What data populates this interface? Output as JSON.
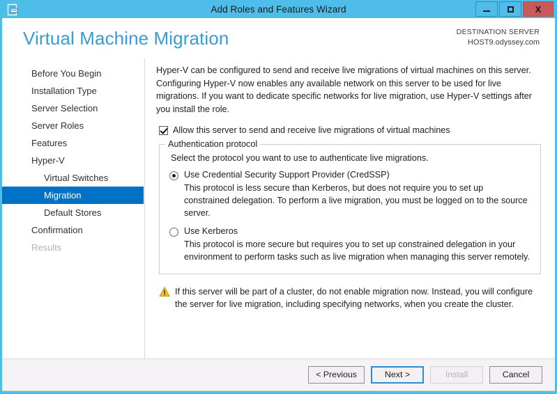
{
  "window": {
    "title": "Add Roles and Features Wizard",
    "icon": "wizard-server-icon",
    "controls": {
      "minimize": "minimize-icon",
      "maximize": "maximize-icon",
      "close": "X"
    },
    "titlebar_color": "#4fbde9",
    "close_color": "#c75b5b"
  },
  "header": {
    "page_title": "Virtual Machine Migration",
    "destination_label": "DESTINATION SERVER",
    "destination_value": "HOST9.odyssey.com",
    "title_color": "#3a9cd4"
  },
  "sidebar": {
    "selected_color": "#0072c6",
    "items": [
      {
        "label": "Before You Begin",
        "level": 0,
        "state": "normal"
      },
      {
        "label": "Installation Type",
        "level": 0,
        "state": "normal"
      },
      {
        "label": "Server Selection",
        "level": 0,
        "state": "normal"
      },
      {
        "label": "Server Roles",
        "level": 0,
        "state": "normal"
      },
      {
        "label": "Features",
        "level": 0,
        "state": "normal"
      },
      {
        "label": "Hyper-V",
        "level": 0,
        "state": "normal"
      },
      {
        "label": "Virtual Switches",
        "level": 1,
        "state": "normal"
      },
      {
        "label": "Migration",
        "level": 1,
        "state": "selected"
      },
      {
        "label": "Default Stores",
        "level": 1,
        "state": "normal"
      },
      {
        "label": "Confirmation",
        "level": 0,
        "state": "normal"
      },
      {
        "label": "Results",
        "level": 0,
        "state": "disabled"
      }
    ]
  },
  "main": {
    "intro": "Hyper-V can be configured to send and receive live migrations of virtual machines on this server. Configuring Hyper-V now enables any available network on this server to be used for live migrations. If you want to dedicate specific networks for live migration, use Hyper-V settings after you install the role.",
    "allow_checkbox": {
      "label": "Allow this server to send and receive live migrations of virtual machines",
      "checked": true
    },
    "group": {
      "legend": "Authentication protocol",
      "intro": "Select the protocol you want to use to authenticate live migrations.",
      "options": [
        {
          "label": "Use Credential Security Support Provider (CredSSP)",
          "description": "This protocol is less secure than Kerberos, but does not require you to set up constrained delegation. To perform a live migration, you must be logged on to the source server.",
          "selected": true
        },
        {
          "label": "Use Kerberos",
          "description": "This protocol is more secure but requires you to set up constrained delegation in your environment to perform tasks such as live migration when managing this server remotely.",
          "selected": false
        }
      ]
    },
    "warning": {
      "icon": "warning-triangle-icon",
      "color": "#f0c419",
      "text": "If this server will be part of a cluster, do not enable migration now. Instead, you will configure the server for live migration, including specifying networks, when you create the cluster."
    }
  },
  "footer": {
    "buttons": [
      {
        "label": "< Previous",
        "state": "normal",
        "name": "previous-button"
      },
      {
        "label": "Next >",
        "state": "default",
        "name": "next-button"
      },
      {
        "label": "Install",
        "state": "disabled",
        "name": "install-button"
      },
      {
        "label": "Cancel",
        "state": "normal",
        "name": "cancel-button"
      }
    ]
  }
}
